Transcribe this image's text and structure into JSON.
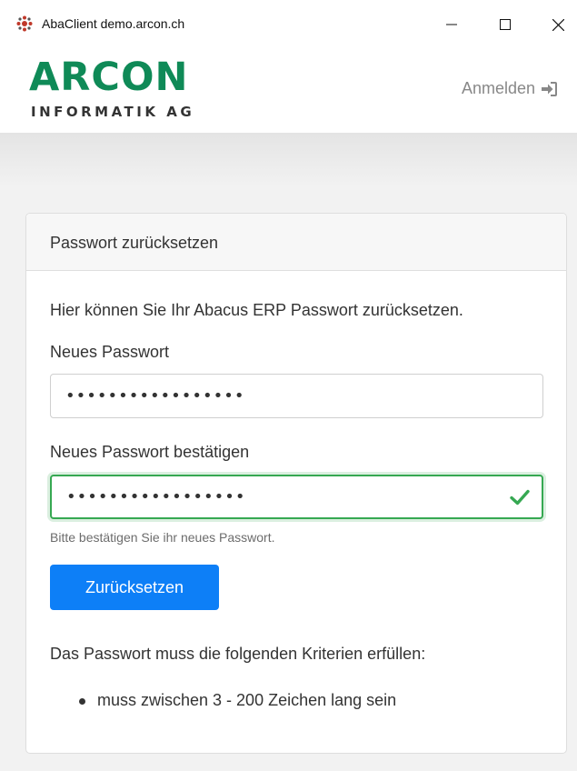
{
  "window": {
    "title": "AbaClient demo.arcon.ch",
    "icons": {
      "app": "abaclient-app-icon",
      "minimize": "minimize-icon",
      "maximize": "maximize-icon",
      "close": "close-icon"
    }
  },
  "header": {
    "logo_main": "ARCON",
    "logo_sub": "INFORMATIK AG",
    "login_label": "Anmelden",
    "login_icon": "sign-in-icon"
  },
  "card": {
    "title": "Passwort zurücksetzen",
    "intro": "Hier können Sie Ihr Abacus ERP Passwort zurücksetzen.",
    "new_password_label": "Neues Passwort",
    "new_password_value": "•••••••••••••••••",
    "confirm_password_label": "Neues Passwort bestätigen",
    "confirm_password_value": "•••••••••••••••••",
    "confirm_help": "Bitte bestätigen Sie ihr neues Passwort.",
    "submit_label": "Zurücksetzen",
    "criteria_title": "Das Passwort muss die folgenden Kriterien erfüllen:",
    "criteria": [
      "muss zwischen 3 - 200 Zeichen lang sein"
    ]
  },
  "colors": {
    "brand_green": "#0f8a57",
    "primary_button": "#0d7ff7",
    "valid_border": "#36a852"
  }
}
